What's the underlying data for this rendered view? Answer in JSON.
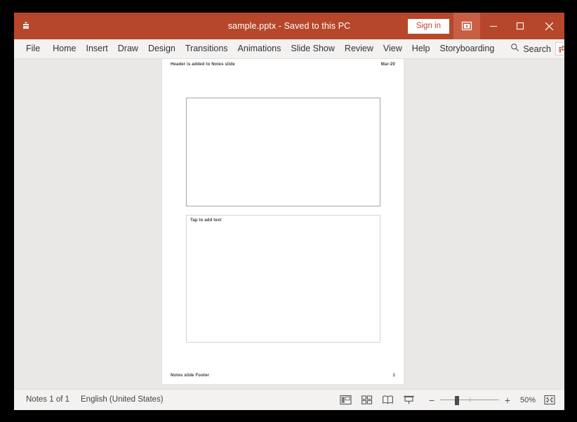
{
  "window": {
    "title": "sample.pptx  -  Saved to this PC",
    "accent_color": "#b7472a",
    "qat_icon": "quick-access-toolbar-icon",
    "signin_label": "Sign in",
    "ribbon_options_icon": "ribbon-display-options-icon",
    "minimize_icon": "minimize-icon",
    "maximize_icon": "maximize-icon",
    "close_icon": "close-icon"
  },
  "menubar": {
    "items": [
      {
        "label": "File"
      },
      {
        "label": "Home"
      },
      {
        "label": "Insert"
      },
      {
        "label": "Draw"
      },
      {
        "label": "Design"
      },
      {
        "label": "Transitions"
      },
      {
        "label": "Animations"
      },
      {
        "label": "Slide Show"
      },
      {
        "label": "Review"
      },
      {
        "label": "View"
      },
      {
        "label": "Help"
      },
      {
        "label": "Storyboarding"
      }
    ],
    "search": {
      "label": "Search",
      "placeholder": "Search",
      "icon": "search-icon"
    },
    "share_icon": "share-icon",
    "comments_icon": "comments-icon"
  },
  "notes_page": {
    "header_left": "Header is added to Notes slide",
    "header_right": "Mar-20",
    "footer_left": "Notes slide Footer",
    "footer_right": "1",
    "notes_placeholder": "Tap to add text",
    "slide_thumbnail_name": "slide-image-placeholder"
  },
  "statusbar": {
    "slide_count": "Notes 1 of 1",
    "language": "English (United States)",
    "views": [
      {
        "name": "normal-view-button",
        "title": "Normal"
      },
      {
        "name": "slide-sorter-view-button",
        "title": "Slide Sorter"
      },
      {
        "name": "reading-view-button",
        "title": "Reading View"
      },
      {
        "name": "slide-show-button",
        "title": "Slide Show"
      }
    ],
    "zoom": {
      "minus_label": "−",
      "plus_label": "+",
      "percent": "50%",
      "value": 50,
      "handle_position_pct": 28
    },
    "fit_window_icon": "fit-slide-to-window-icon"
  }
}
